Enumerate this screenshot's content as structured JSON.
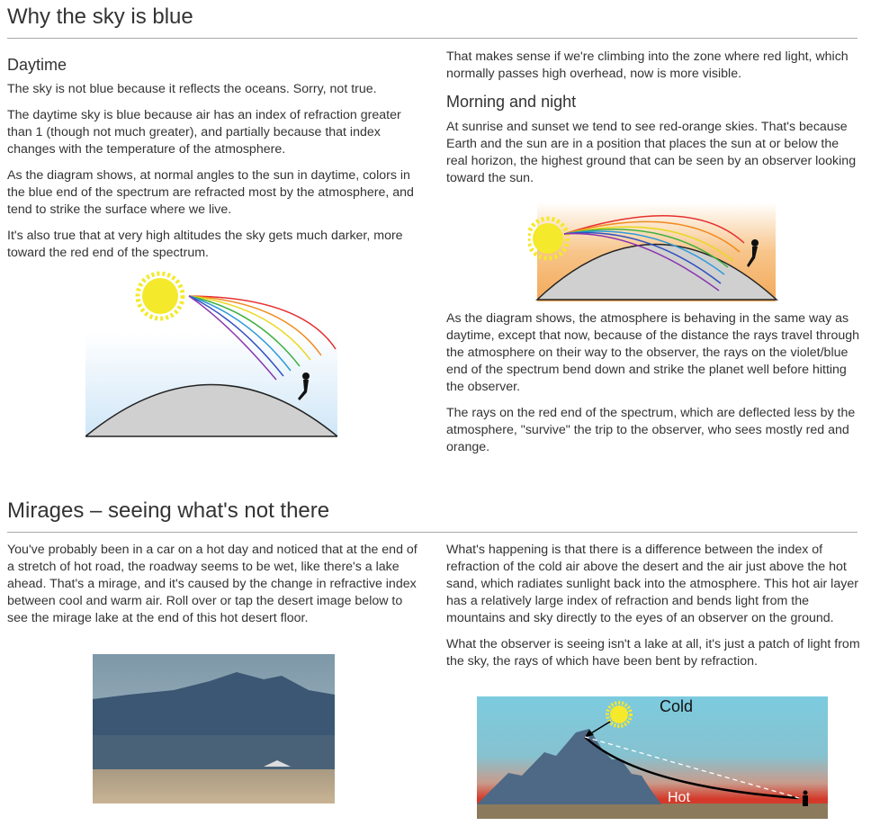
{
  "section1": {
    "title": "Why the sky is blue",
    "daytime": {
      "heading": "Daytime",
      "paragraphs": [
        "The sky is not blue because it reflects the oceans. Sorry, not true.",
        "The daytime sky is blue because air has an index of refraction greater than 1 (though not much greater), and partially because that index changes with the temperature of the atmosphere.",
        "As the diagram shows, at normal angles to the sun in daytime, colors in the blue end of the spectrum are refracted most by the atmosphere, and tend to strike the surface where we live.",
        "It's also true that at very high altitudes the sky gets much darker, more toward the red end of the spectrum."
      ]
    },
    "right_intro": "That makes sense if we're climbing into the zone where red light, which normally passes high overhead, now is more visible.",
    "morning": {
      "heading": "Morning and night",
      "paragraphs": [
        "At sunrise and sunset we tend to see red-orange skies. That's because Earth and the sun are in a position that places the sun at or below the real horizon, the highest ground that can be seen by an observer looking toward the sun.",
        "As the diagram shows, the atmosphere is behaving in the same way as daytime, except that now, because of the distance the rays travel through the atmosphere on their way to the observer, the rays on the violet/blue end of the spectrum bend down and strike the planet well before hitting the observer.",
        "The rays on the red end of the spectrum, which are deflected less by the atmosphere, \"survive\" the trip to the observer, who sees mostly red and orange."
      ]
    }
  },
  "section2": {
    "title": "Mirages – seeing what's not there",
    "left_paragraph": "You've probably been in a car on a hot day and noticed that at the end of a stretch of hot road, the roadway seems to be wet, like there's a lake ahead. That's a mirage, and it's caused by the change in refractive index between cool and warm air. Roll over or tap the desert image below to see the mirage lake at the end of this hot desert floor.",
    "right_paragraphs": [
      "What's happening is that there is a difference between the index of refraction of the cold air above the desert and the air just above the hot sand, which radiates sunlight back into the atmosphere. This hot air layer has a relatively large index of refraction and bends light from the mountains and sky directly to the eyes of an observer on the ground.",
      "What the observer is seeing isn't a lake at all, it's just a patch of light from the sky, the rays of which have been bent by refraction."
    ],
    "diagram_labels": {
      "cold": "Cold",
      "hot": "Hot"
    }
  }
}
